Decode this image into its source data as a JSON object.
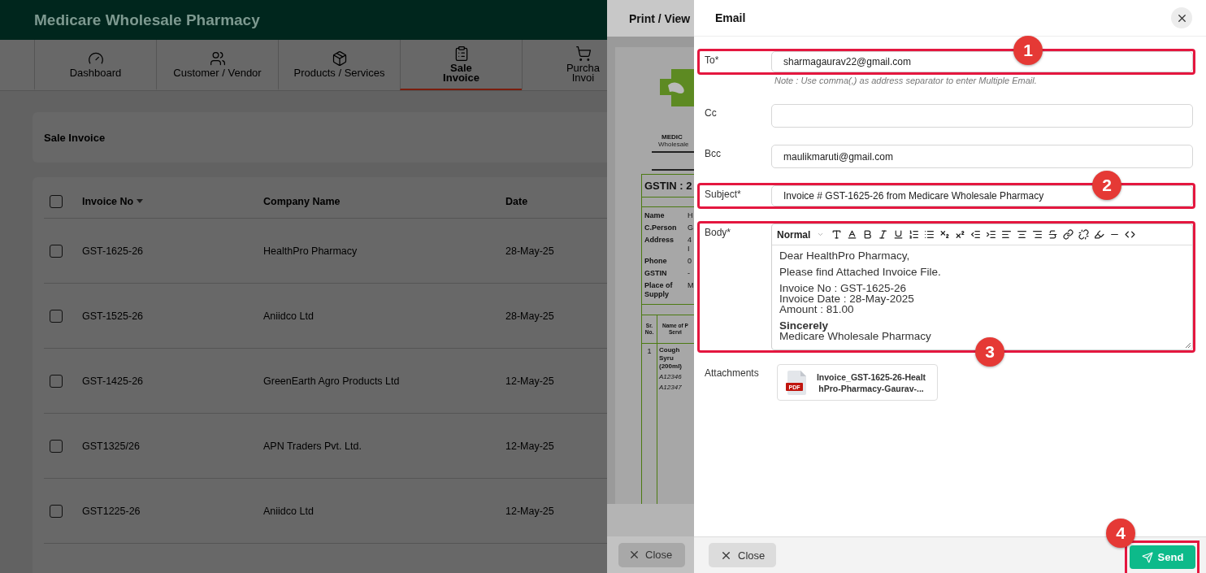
{
  "app": {
    "title": "Medicare Wholesale Pharmacy",
    "nav": [
      {
        "lines": [
          "Dashboard"
        ],
        "selected": false
      },
      {
        "lines": [
          "Customer / Vendor"
        ],
        "selected": false
      },
      {
        "lines": [
          "Products / Services"
        ],
        "selected": false
      },
      {
        "lines": [
          "Sale",
          "Invoice"
        ],
        "selected": true
      },
      {
        "lines": [
          "Purcha",
          "Invoi"
        ],
        "selected": false
      }
    ],
    "page_title": "Sale Invoice",
    "table": {
      "all_checked": false,
      "columns": [
        {
          "label": "Invoice No",
          "sorted": true
        },
        {
          "label": "Company Name",
          "sorted": false
        },
        {
          "label": "Date",
          "sorted": false
        }
      ],
      "rows": [
        {
          "checked": false,
          "cells": [
            "GST-1625-26",
            "HealthPro Pharmacy",
            "28-May-25"
          ]
        },
        {
          "checked": false,
          "cells": [
            "GST-1525-26",
            "Aniidco Ltd",
            "28-May-25"
          ]
        },
        {
          "checked": false,
          "cells": [
            "GST-1425-26",
            "GreenEarth Agro Products Ltd",
            "12-May-25"
          ]
        },
        {
          "checked": false,
          "cells": [
            "GST1325/26",
            "APN Traders Pvt. Ltd.",
            "12-May-25"
          ]
        },
        {
          "checked": false,
          "cells": [
            "GST1225-26",
            "Aniidco Ltd",
            "12-May-25"
          ]
        }
      ]
    }
  },
  "print_view": {
    "title": "Print / View",
    "close": "Close",
    "preview": {
      "brand": "MEDIC",
      "brand_sub": "Wholesale",
      "gstin": "GSTIN : 2",
      "details": [
        {
          "label": "Name",
          "values": [
            "H"
          ]
        },
        {
          "label": "C.Person",
          "values": [
            "G"
          ]
        },
        {
          "label": "Address",
          "values": [
            "4",
            "I"
          ]
        },
        {
          "label": "Phone",
          "values": [
            "0"
          ]
        },
        {
          "label": "GSTIN",
          "values": [
            "-"
          ]
        },
        {
          "label": "Place of Supply",
          "values": [
            "M"
          ]
        }
      ],
      "item_columns": [
        [
          "Sr.",
          "No."
        ],
        [
          "Name of P",
          "Servi"
        ]
      ],
      "items": [
        {
          "sr": "1",
          "name": [
            "Cough Syru",
            "(200ml)"
          ],
          "batches": [
            "A12346",
            "A12347"
          ]
        }
      ]
    }
  },
  "email": {
    "title": "Email",
    "fields": [
      {
        "label": "To*",
        "value": "sharmagaurav22@gmail.com",
        "note": "Note : Use comma(,) as address separator to enter Multiple Email.",
        "callout": "1"
      },
      {
        "label": "Cc"
      },
      {
        "label": "Bcc",
        "value": "maulikmaruti@gmail.com"
      },
      {
        "label": "Subject*",
        "value": "Invoice # GST-1625-26 from Medicare Wholesale Pharmacy",
        "callout": "2"
      }
    ],
    "body": {
      "label": "Body*",
      "format": "Normal",
      "callout": "3",
      "blocks": [
        [
          {
            "text": "Dear HealthPro Pharmacy,",
            "bold": false
          }
        ],
        [
          {
            "text": "Please find Attached Invoice File.",
            "bold": false
          }
        ],
        [
          {
            "text": "Invoice No : GST-1625-26",
            "bold": false
          },
          {
            "text": "Invoice Date : 28-May-2025",
            "bold": false
          },
          {
            "text": "Amount : 81.00",
            "bold": false
          }
        ],
        [
          {
            "text": "Sincerely",
            "bold": true
          },
          {
            "text": "Medicare Wholesale Pharmacy",
            "bold": false
          }
        ]
      ]
    },
    "attachments": {
      "label": "Attachments",
      "files": [
        {
          "badge": "PDF",
          "name": "Invoice_GST-1625-26-HealthPro-Pharmacy-Gaurav-..."
        }
      ]
    },
    "close": "Close",
    "send": {
      "label": "Send",
      "callout": "4"
    }
  }
}
